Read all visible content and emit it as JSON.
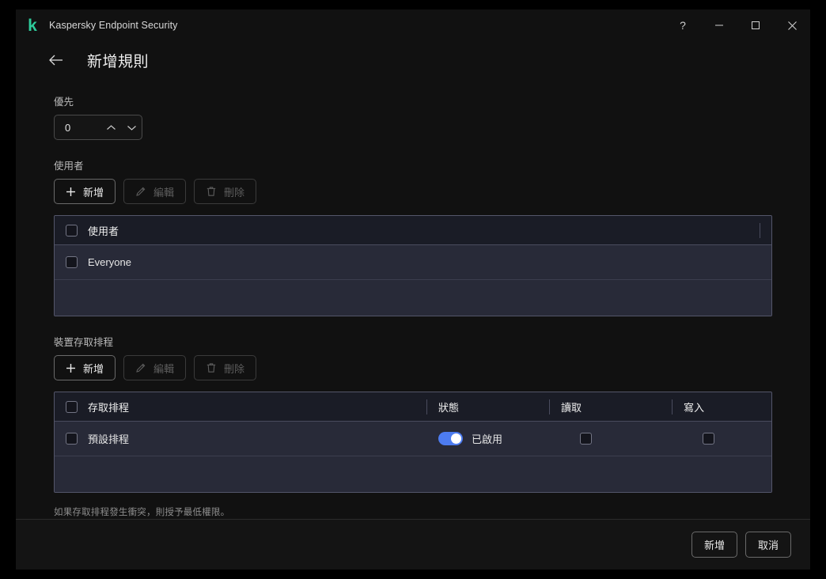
{
  "titlebar": {
    "app_name": "Kaspersky Endpoint Security",
    "logo_glyph": "k",
    "logo_color": "#2ecc9b",
    "help_label": "?",
    "minimize_label": "minimize",
    "maximize_label": "maximize",
    "close_label": "close"
  },
  "header": {
    "back_label": "back",
    "title": "新增規則"
  },
  "priority": {
    "label": "優先",
    "value": "0",
    "increment_label": "increment",
    "decrement_label": "decrement"
  },
  "users_section": {
    "label": "使用者",
    "toolbar": {
      "add": "新增",
      "edit": "編輯",
      "delete": "刪除"
    },
    "columns": [
      "使用者"
    ],
    "rows": [
      {
        "name": "Everyone",
        "checked": false
      }
    ],
    "header_checked": false
  },
  "schedule_section": {
    "label": "裝置存取排程",
    "toolbar": {
      "add": "新增",
      "edit": "編輯",
      "delete": "刪除"
    },
    "columns": [
      "存取排程",
      "狀態",
      "讀取",
      "寫入"
    ],
    "rows": [
      {
        "name": "預設排程",
        "checked": false,
        "status_enabled": true,
        "status_text": "已啟用",
        "read_checked": false,
        "write_checked": false
      }
    ],
    "header_checked": false
  },
  "note": "如果存取排程發生衝突，則授予最低權限。",
  "footer": {
    "confirm": "新增",
    "cancel": "取消"
  },
  "colors": {
    "accent_toggle": "#4d7cf0",
    "brand": "#2ecc9b",
    "table_header_bg": "#1a1c26",
    "table_row_bg": "#282a38",
    "window_bg": "#111111"
  }
}
